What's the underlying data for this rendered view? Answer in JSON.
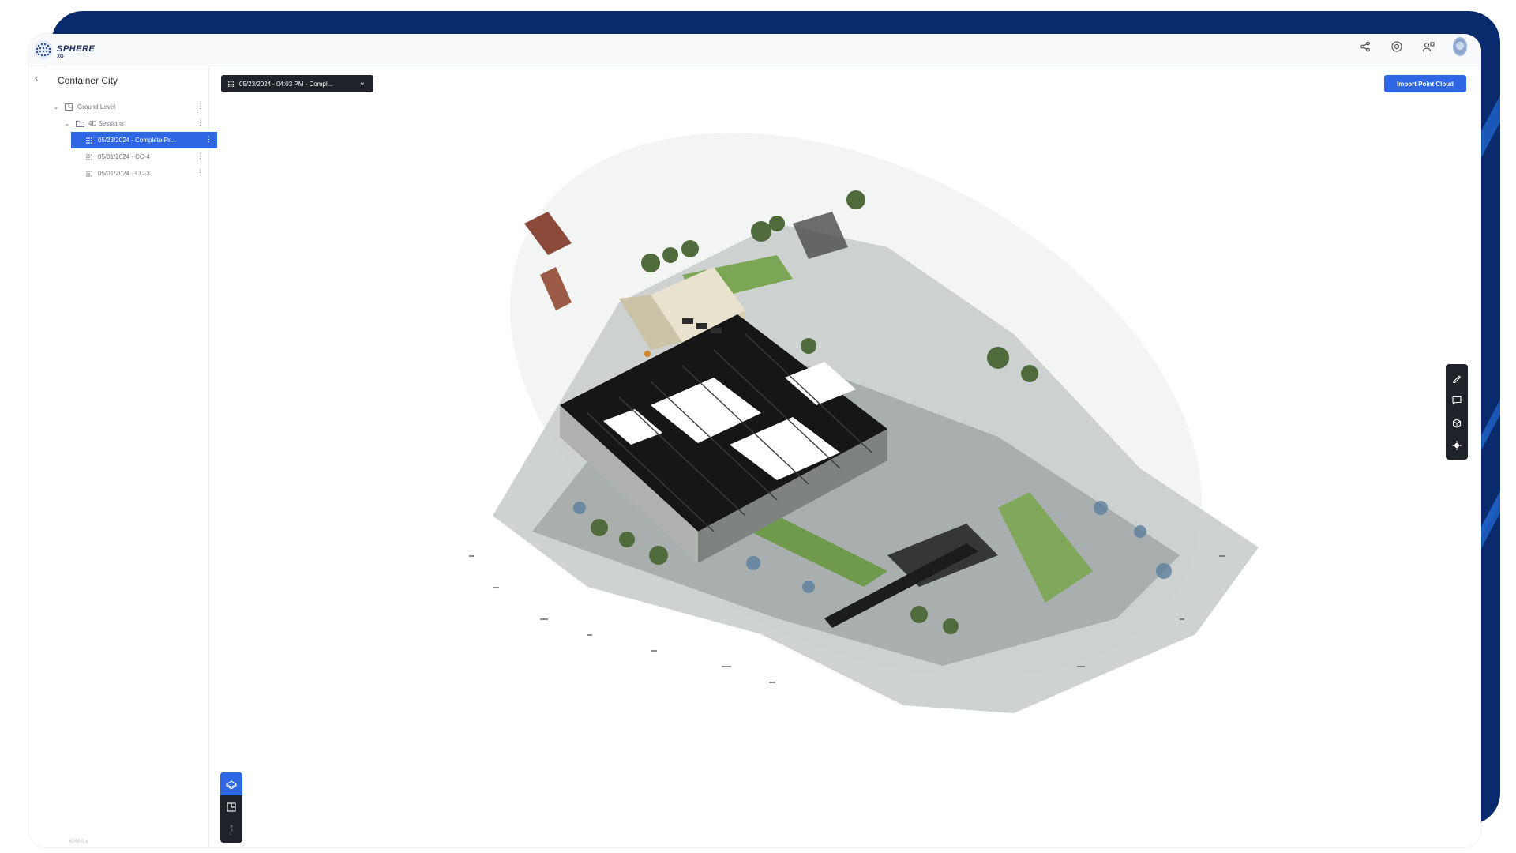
{
  "app": {
    "logo_text": "SPHERE",
    "logo_sub": "XG"
  },
  "header": {
    "icons": [
      "share-icon",
      "help-icon",
      "user-settings-icon",
      "avatar"
    ]
  },
  "sidebar": {
    "project_title": "Container City",
    "tree": [
      {
        "label": "Ground Level",
        "level": 0,
        "icon": "floor-plan-icon",
        "expanded": true
      },
      {
        "label": "4D Sessions",
        "level": 1,
        "icon": "folder-icon",
        "expanded": true
      },
      {
        "label": "05/23/2024 - Complete Pr...",
        "level": 2,
        "icon": "point-cloud-icon",
        "selected": true
      },
      {
        "label": "05/01/2024 - CC-4",
        "level": 2,
        "icon": "point-cloud-icon",
        "selected": false
      },
      {
        "label": "05/01/2024 - CC-3",
        "level": 2,
        "icon": "point-cloud-icon",
        "selected": false
      }
    ],
    "version": "6740.0.x"
  },
  "toolbar": {
    "session_select": "05/23/2024 - 04:03 PM - Compl...",
    "import_label": "Import Point Cloud"
  },
  "right_tools": [
    "measure-icon",
    "comment-icon",
    "cube-view-icon",
    "settings-icon"
  ],
  "view_modes": [
    "3d-view-icon",
    "floor-plan-view-icon",
    "walk-mode-icon"
  ],
  "colors": {
    "accent": "#2f66e3",
    "toolbar_dark": "#1f2228",
    "backdrop": "#0a2a6e"
  }
}
